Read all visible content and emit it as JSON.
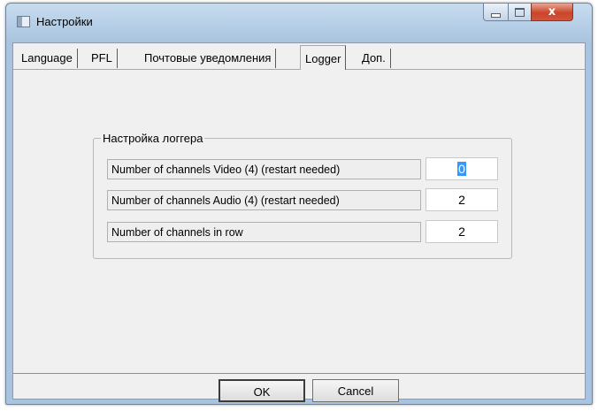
{
  "window": {
    "title": "Настройки",
    "controls": {
      "minimize_icon": "minimize-icon",
      "maximize_icon": "maximize-icon",
      "close_glyph": "x"
    }
  },
  "tabs": [
    {
      "label": "Language",
      "active": false
    },
    {
      "label": "PFL",
      "active": false
    },
    {
      "label": "Почтовые уведомления",
      "active": false
    },
    {
      "label": "Logger",
      "active": true
    },
    {
      "label": "Доп.",
      "active": false
    }
  ],
  "logger_group": {
    "title": "Настройка логгера",
    "rows": [
      {
        "label": "Number of channels Video (4) (restart needed)",
        "value": "0"
      },
      {
        "label": "Number of channels Audio (4) (restart needed)",
        "value": "2"
      },
      {
        "label": "Number of channels in row",
        "value": "2"
      }
    ]
  },
  "buttons": {
    "ok": "OK",
    "cancel": "Cancel"
  }
}
